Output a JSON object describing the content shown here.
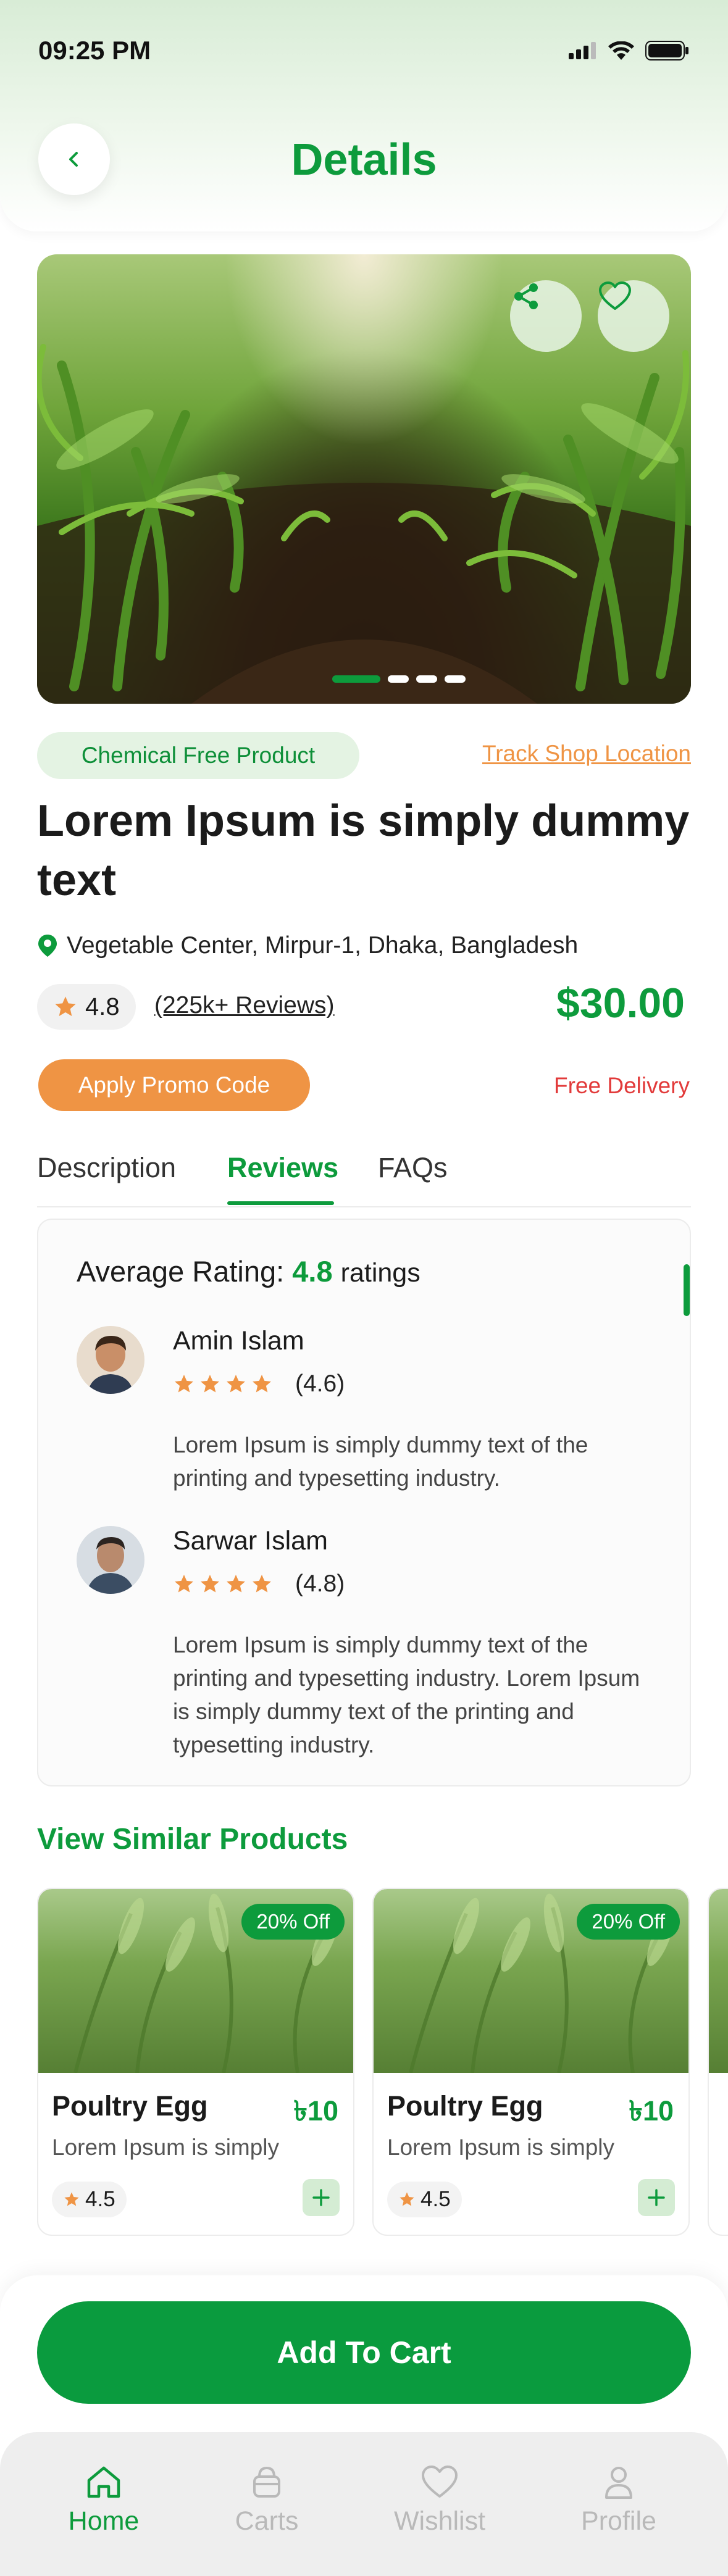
{
  "status_bar": {
    "time": "09:25 PM"
  },
  "header": {
    "title": "Details"
  },
  "product": {
    "tag": "Chemical Free Product",
    "track_link": "Track Shop Location",
    "title": "Lorem Ipsum is simply dummy text",
    "location": "Vegetable Center, Mirpur-1, Dhaka, Bangladesh",
    "rating": "4.8",
    "reviews_count": "(225k+ Reviews)",
    "price": "$30.00",
    "promo_label": "Apply Promo Code",
    "delivery": "Free Delivery",
    "carousel_slides": 4,
    "carousel_active": 0
  },
  "tabs": [
    {
      "label": "Description",
      "active": false
    },
    {
      "label": "Reviews",
      "active": true
    },
    {
      "label": "FAQs",
      "active": false
    }
  ],
  "reviews_panel": {
    "avg_prefix": "Average Rating:",
    "avg_value": "4.8",
    "avg_suffix": "ratings",
    "items": [
      {
        "name": "Amin Islam",
        "stars": 4,
        "score": "(4.6)",
        "text": "Lorem Ipsum is simply dummy text of the printing and typesetting industry."
      },
      {
        "name": "Sarwar Islam",
        "stars": 4,
        "score": "(4.8)",
        "text": "Lorem Ipsum is simply dummy text of the printing and typesetting industry. Lorem Ipsum is simply dummy text of the printing and typesetting industry."
      }
    ]
  },
  "similar": {
    "title": "View Similar Products",
    "cards": [
      {
        "badge": "20% Off",
        "name": "Poultry Egg",
        "price": "৳10",
        "desc": "Lorem Ipsum is simply",
        "rating": "4.5"
      },
      {
        "badge": "20% Off",
        "name": "Poultry Egg",
        "price": "৳10",
        "desc": "Lorem Ipsum is simply",
        "rating": "4.5"
      }
    ]
  },
  "cta": {
    "label": "Add To Cart"
  },
  "nav": [
    {
      "label": "Home",
      "icon": "home-icon",
      "active": true
    },
    {
      "label": "Carts",
      "icon": "basket-icon",
      "active": false
    },
    {
      "label": "Wishlist",
      "icon": "heart-icon",
      "active": false
    },
    {
      "label": "Profile",
      "icon": "user-icon",
      "active": false
    }
  ],
  "colors": {
    "primary": "#0d9b3c",
    "accent": "#ef9444",
    "danger": "#e23a3a"
  }
}
